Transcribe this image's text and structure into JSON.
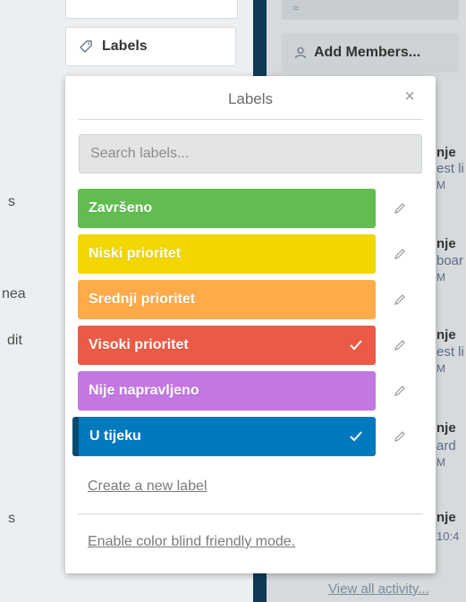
{
  "left_panel": {
    "fragments": [
      "s",
      "nea",
      "dit",
      "s"
    ],
    "labels_button": "Labels"
  },
  "right_panel": {
    "top_glyph": "≈",
    "add_members": "Add Members...",
    "cards": [
      {
        "title": "nje",
        "sub": "est li",
        "time": "M"
      },
      {
        "title": "nje",
        "sub": "boar",
        "time": "M"
      },
      {
        "title": "nje",
        "sub": "est li",
        "time": "M"
      },
      {
        "title": "nje",
        "sub": "ard",
        "time": "M"
      },
      {
        "title": "nje",
        "sub": "10:4",
        "time": ""
      }
    ],
    "view_all": "View all activity..."
  },
  "popup": {
    "title": "Labels",
    "close": "×",
    "search_placeholder": "Search labels...",
    "labels": [
      {
        "name": "Završeno",
        "color": "#61bd4f",
        "selected": false
      },
      {
        "name": "Niski prioritet",
        "color": "#f2d600",
        "selected": false
      },
      {
        "name": "Srednji prioritet",
        "color": "#ffab4a",
        "selected": false
      },
      {
        "name": "Visoki prioritet",
        "color": "#eb5a46",
        "selected": true
      },
      {
        "name": "Nije napravljeno",
        "color": "#c377e0",
        "selected": false
      },
      {
        "name": "U tijeku",
        "color": "#0079bf",
        "selected": true
      }
    ],
    "create_link": "Create a new label",
    "colorblind_link": "Enable color blind friendly mode."
  }
}
